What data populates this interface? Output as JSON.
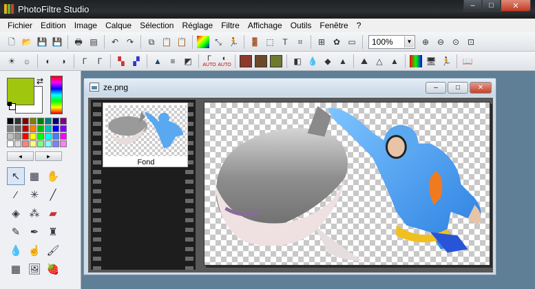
{
  "app": {
    "title": "PhotoFiltre Studio"
  },
  "window_controls": {
    "minimize": "–",
    "maximize": "□",
    "close": "✕"
  },
  "menu": [
    "Fichier",
    "Edition",
    "Image",
    "Calque",
    "Sélection",
    "Réglage",
    "Filtre",
    "Affichage",
    "Outils",
    "Fenêtre",
    "?"
  ],
  "toolbar1": {
    "icons": [
      "new-file-icon",
      "open-folder-icon",
      "save-icon",
      "save-as-icon",
      "print-icon",
      "scanner-icon",
      "undo-icon",
      "redo-icon",
      "copy-icon",
      "paste-icon",
      "paste-new-icon",
      "color-gradient-icon",
      "transform-icon",
      "run-icon",
      "exit-icon",
      "selection-icon",
      "text-icon",
      "crop-icon",
      "layer-icon",
      "puzzle-icon",
      "slideshow-icon",
      "zoom-in-icon",
      "zoom-out-icon",
      "zoom-fit-icon",
      "zoom-actual-icon"
    ],
    "zoom_value": "100%"
  },
  "toolbar2": {
    "icons": [
      "brightness-plus-icon",
      "brightness-minus-icon",
      "contrast-plus-icon",
      "contrast-minus-icon",
      "gamma-plus-icon",
      "gamma-minus-icon",
      "saturation-plus-icon",
      "saturation-minus-icon",
      "levels-icon",
      "equalize-icon",
      "invert-icon",
      "auto-level-icon",
      "auto-contrast-icon",
      "tile-red-icon",
      "tile-brown-icon",
      "tile-olive-icon",
      "filter-a-icon",
      "drop-icon",
      "drop-b-icon",
      "drop-c-icon",
      "mountain-icon",
      "mountain-b-icon",
      "cone-icon",
      "rgb-icon",
      "monitor-icon",
      "person-icon",
      "book-icon"
    ],
    "auto_label": "AUTO"
  },
  "colors": {
    "foreground": "#a0c60e",
    "background": "#ffffff"
  },
  "palette": [
    "#000000",
    "#333333",
    "#800000",
    "#808000",
    "#008000",
    "#008080",
    "#000080",
    "#800080",
    "#808080",
    "#666666",
    "#c00000",
    "#ff8000",
    "#00c000",
    "#00c0c0",
    "#0000ff",
    "#8000ff",
    "#c0c0c0",
    "#999999",
    "#ff0000",
    "#ffff00",
    "#00ff00",
    "#00ffff",
    "#4080ff",
    "#ff00ff",
    "#ffffff",
    "#dddddd",
    "#ff8080",
    "#ffff80",
    "#80ff80",
    "#80ffff",
    "#8080ff",
    "#ff80ff"
  ],
  "palette_nav": {
    "prev": "◄",
    "next": "►"
  },
  "tools": [
    "pointer-icon",
    "layer-manager-icon",
    "hand-icon",
    "eyedropper-icon",
    "magic-wand-icon",
    "line-icon",
    "fill-bucket-icon",
    "spray-icon",
    "eraser-icon",
    "brush-icon",
    "pen-icon",
    "stamp-icon",
    "blur-drop-icon",
    "smudge-icon",
    "paint-icon",
    "grid-icon",
    "portrait-icon",
    "strawberry-icon"
  ],
  "document": {
    "title": "ze.png"
  },
  "layers": [
    {
      "name": "Fond"
    }
  ]
}
